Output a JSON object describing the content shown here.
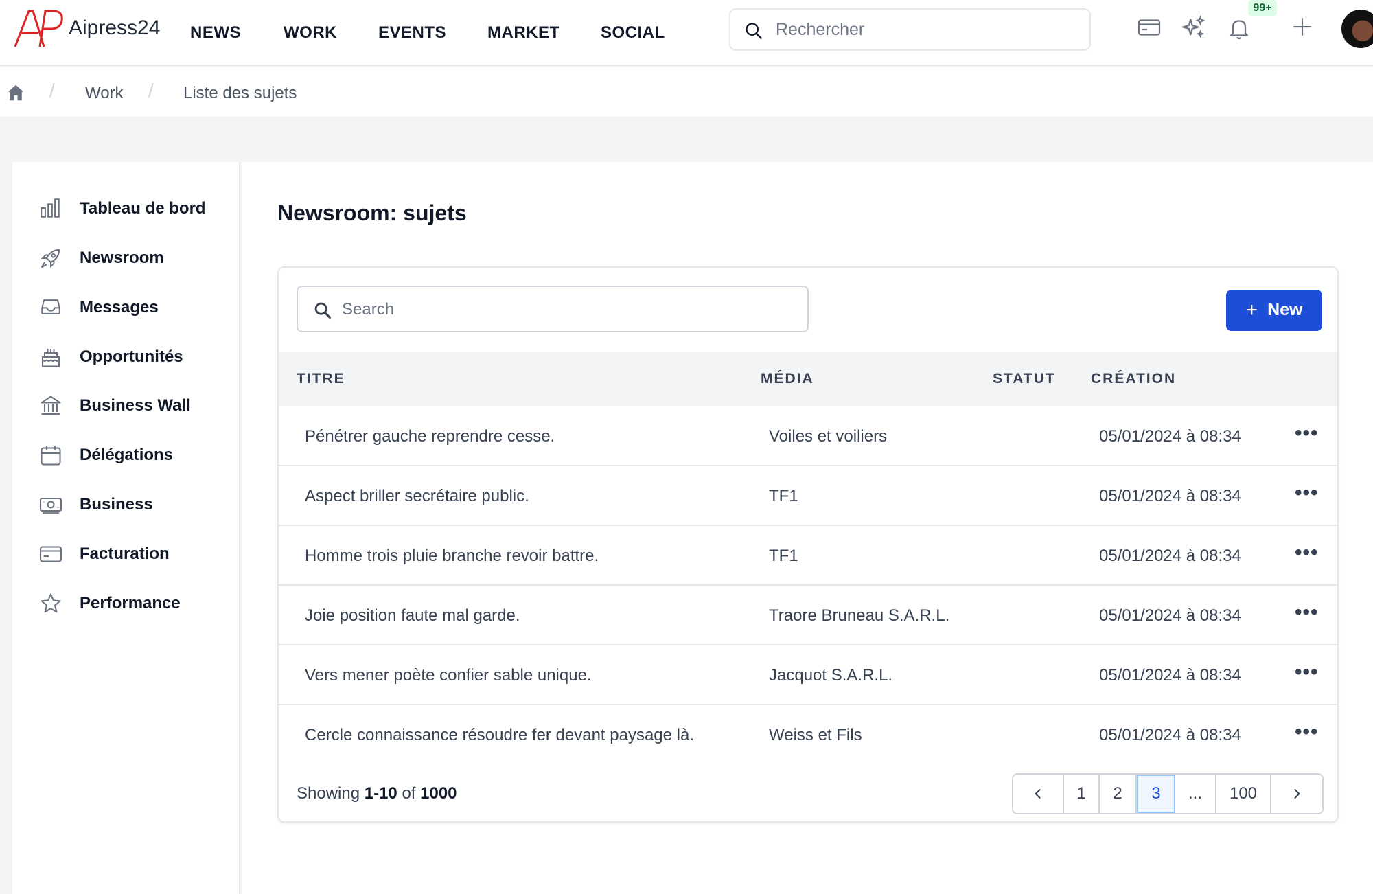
{
  "header": {
    "brand": "Aipress24",
    "nav": [
      "NEWS",
      "WORK",
      "EVENTS",
      "MARKET",
      "SOCIAL"
    ],
    "search_placeholder": "Rechercher",
    "notifications_badge": "99+"
  },
  "breadcrumb": {
    "items": [
      "Work",
      "Liste des sujets"
    ]
  },
  "sidebar": {
    "items": [
      {
        "label": "Tableau de bord",
        "icon": "bar-chart-icon"
      },
      {
        "label": "Newsroom",
        "icon": "rocket-icon"
      },
      {
        "label": "Messages",
        "icon": "inbox-icon"
      },
      {
        "label": "Opportunités",
        "icon": "cake-icon"
      },
      {
        "label": "Business Wall",
        "icon": "bank-icon"
      },
      {
        "label": "Délégations",
        "icon": "calendar-icon"
      },
      {
        "label": "Business",
        "icon": "cash-icon"
      },
      {
        "label": "Facturation",
        "icon": "credit-card-icon"
      },
      {
        "label": "Performance",
        "icon": "star-icon"
      }
    ]
  },
  "main": {
    "title": "Newsroom: sujets",
    "search_placeholder": "Search",
    "new_button": "New",
    "columns": [
      "TITRE",
      "MÉDIA",
      "STATUT",
      "CRÉATION"
    ],
    "rows": [
      {
        "titre": "Pénétrer gauche reprendre cesse.",
        "media": "Voiles et voiliers",
        "statut": "",
        "creation": "05/01/2024 à 08:34"
      },
      {
        "titre": "Aspect briller secrétaire public.",
        "media": "TF1",
        "statut": "",
        "creation": "05/01/2024 à 08:34"
      },
      {
        "titre": "Homme trois pluie branche revoir battre.",
        "media": "TF1",
        "statut": "",
        "creation": "05/01/2024 à 08:34"
      },
      {
        "titre": "Joie position faute mal garde.",
        "media": "Traore Bruneau S.A.R.L.",
        "statut": "",
        "creation": "05/01/2024 à 08:34"
      },
      {
        "titre": "Vers mener poète confier sable unique.",
        "media": "Jacquot S.A.R.L.",
        "statut": "",
        "creation": "05/01/2024 à 08:34"
      },
      {
        "titre": "Cercle connaissance résoudre fer devant paysage là.",
        "media": "Weiss et Fils",
        "statut": "",
        "creation": "05/01/2024 à 08:34"
      }
    ],
    "row_menu": "•••",
    "pagination": {
      "showing_prefix": "Showing",
      "range": "1-10",
      "of": "of",
      "total": "1000",
      "pages": [
        "1",
        "2",
        "3",
        "...",
        "100"
      ],
      "active": "3"
    }
  },
  "colors": {
    "accent": "#1d4ed8",
    "logo_red": "#dc2626",
    "badge_bg": "#dcfce7"
  }
}
